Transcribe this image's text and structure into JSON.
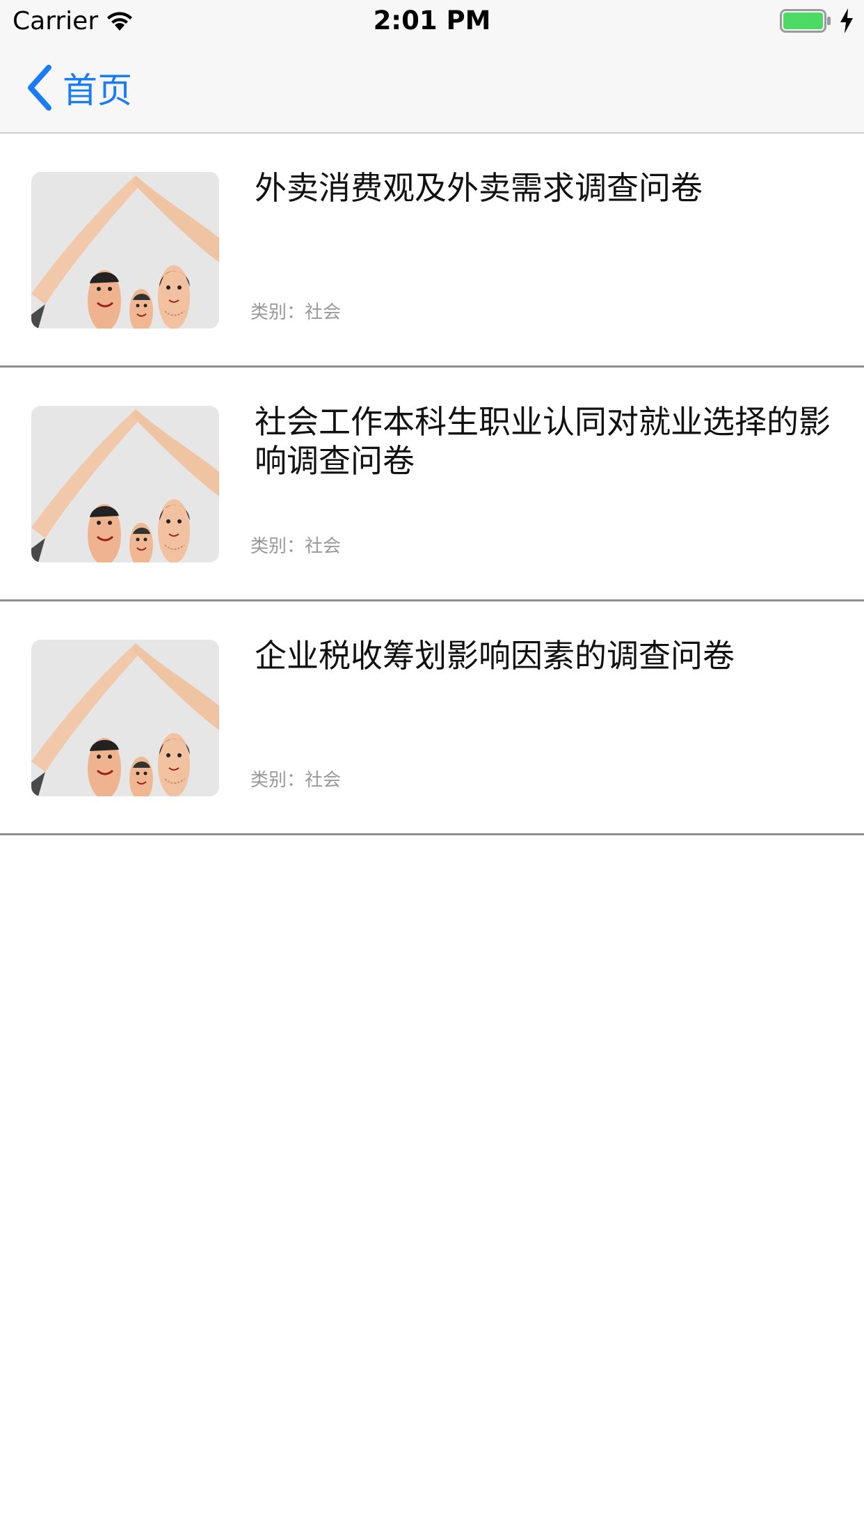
{
  "status_bar": {
    "carrier": "Carrier",
    "time": "2:01 PM",
    "battery_color": "#4cd964"
  },
  "nav": {
    "back_label": "首页",
    "accent_color": "#1a7cf5"
  },
  "items": [
    {
      "title": "外卖消费观及外卖需求调查问卷",
      "category": "类别：社会"
    },
    {
      "title": "社会工作本科生职业认同对就业选择的影响调查问卷",
      "category": "类别：社会"
    },
    {
      "title": "企业税收筹划影响因素的调查问卷",
      "category": "类别：社会"
    }
  ]
}
